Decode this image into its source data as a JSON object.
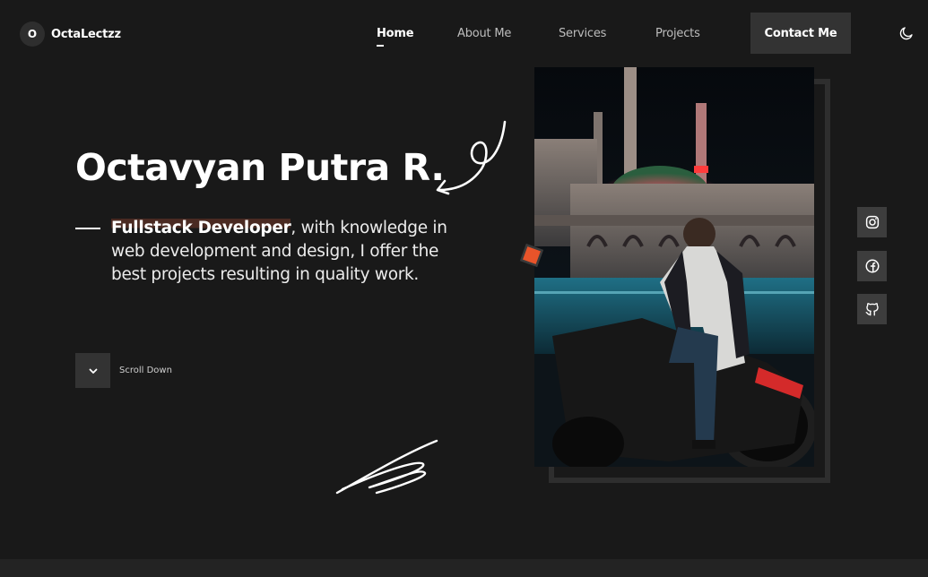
{
  "logo": {
    "badge": "O",
    "text": "OctaLectzz"
  },
  "nav": {
    "links": [
      "Home",
      "About Me",
      "Services",
      "Projects"
    ],
    "active": "Home",
    "contact_label": "Contact Me"
  },
  "hero": {
    "name": "Octavyan Putra R.",
    "role": "Fullstack Developer",
    "description": ", with knowledge in web development and design, I offer the best projects resulting in quality work.",
    "scroll_label": "Scroll Down"
  },
  "social": [
    "instagram-icon",
    "facebook-icon",
    "github-icon"
  ],
  "colors": {
    "background": "#191919",
    "button": "#333333",
    "accent": "#e8542a",
    "highlight": "#4a2a22"
  }
}
